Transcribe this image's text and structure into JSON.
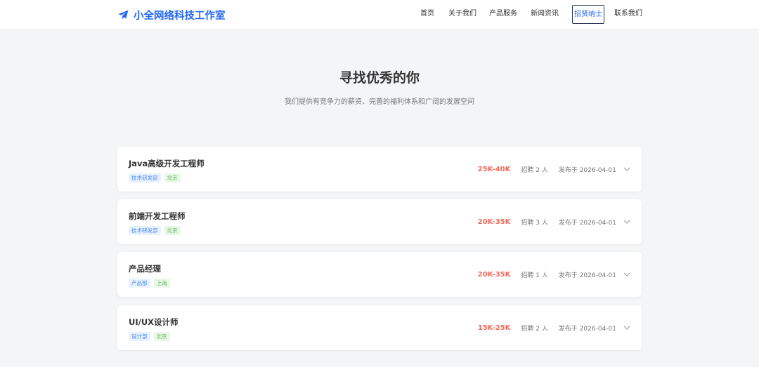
{
  "brand": {
    "name": "小全网络科技工作室",
    "icon": "paper-plane-icon",
    "color": "#2468f2"
  },
  "nav": {
    "items": [
      {
        "label": "首页",
        "active": false
      },
      {
        "label": "关于我们",
        "active": false
      },
      {
        "label": "产品服务",
        "active": false
      },
      {
        "label": "新闻资讯",
        "active": false
      },
      {
        "label": "招贤纳士",
        "active": true
      },
      {
        "label": "联系我们",
        "active": false
      }
    ]
  },
  "hero": {
    "title": "寻找优秀的你",
    "subtitle": "我们提供有竞争力的薪资、完善的福利体系和广阔的发展空间"
  },
  "jobs": [
    {
      "title": "Java高级开发工程师",
      "dept": "技术研发部",
      "city": "北京",
      "salary": "25K-40K",
      "headcount": "招聘 2 人",
      "posted": "发布于 2026-04-01"
    },
    {
      "title": "前端开发工程师",
      "dept": "技术研发部",
      "city": "北京",
      "salary": "20K-35K",
      "headcount": "招聘 3 人",
      "posted": "发布于 2026-04-01"
    },
    {
      "title": "产品经理",
      "dept": "产品部",
      "city": "上海",
      "salary": "20K-35K",
      "headcount": "招聘 1 人",
      "posted": "发布于 2026-04-01"
    },
    {
      "title": "UI/UX设计师",
      "dept": "设计部",
      "city": "北京",
      "salary": "15K-25K",
      "headcount": "招聘 2 人",
      "posted": "发布于 2026-04-01"
    }
  ],
  "colors": {
    "accent": "#2468f2",
    "salary": "#f26b5b",
    "dept_tag": "#4a8af4",
    "city_tag": "#5cb85c",
    "background": "#f4f5f7"
  }
}
